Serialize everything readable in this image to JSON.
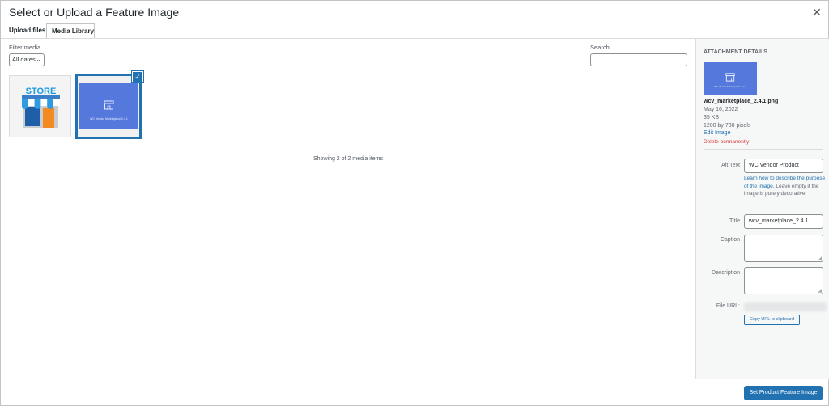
{
  "modal": {
    "title": "Select or Upload a Feature Image",
    "close_icon": "close-icon"
  },
  "tabs": [
    {
      "label": "Upload files"
    },
    {
      "label": "Media Library"
    }
  ],
  "toolbar": {
    "filter_label": "Filter media",
    "filter_value": "All dates",
    "search_label": "Search",
    "search_value": ""
  },
  "media": {
    "items": [
      {
        "name": "store-thumbnail",
        "label": "STORE"
      },
      {
        "name": "wc-vendor-thumbnail",
        "label": "WC Vendor Marketplace 2.4.1",
        "selected": true
      }
    ],
    "showing": "Showing 2 of 2 media items"
  },
  "attachment": {
    "heading": "ATTACHMENT DETAILS",
    "filename": "wcv_marketplace_2.4.1.png",
    "date": "May 16, 2022",
    "size": "35 KB",
    "dimensions": "1200 by 730 pixels",
    "edit_link": "Edit Image",
    "delete_link": "Delete permanently",
    "thumb_caption": "WC Vendor Marketplace 2.4.1"
  },
  "fields": {
    "alt_label": "Alt Text",
    "alt_value": "WC Vendor Product",
    "alt_help_link": "Learn how to describe the purpose of the image",
    "alt_help_rest": ". Leave empty if the image is purely decorative.",
    "title_label": "Title",
    "title_value": "wcv_marketplace_2.4.1",
    "caption_label": "Caption",
    "caption_value": "",
    "description_label": "Description",
    "description_value": "",
    "url_label": "File URL:",
    "copy_button": "Copy URL to clipboard"
  },
  "footer": {
    "primary_button": "Set Product Feature Image"
  },
  "colors": {
    "accent": "#2271b1",
    "danger": "#d63638",
    "thumb_blue": "#5478db"
  }
}
